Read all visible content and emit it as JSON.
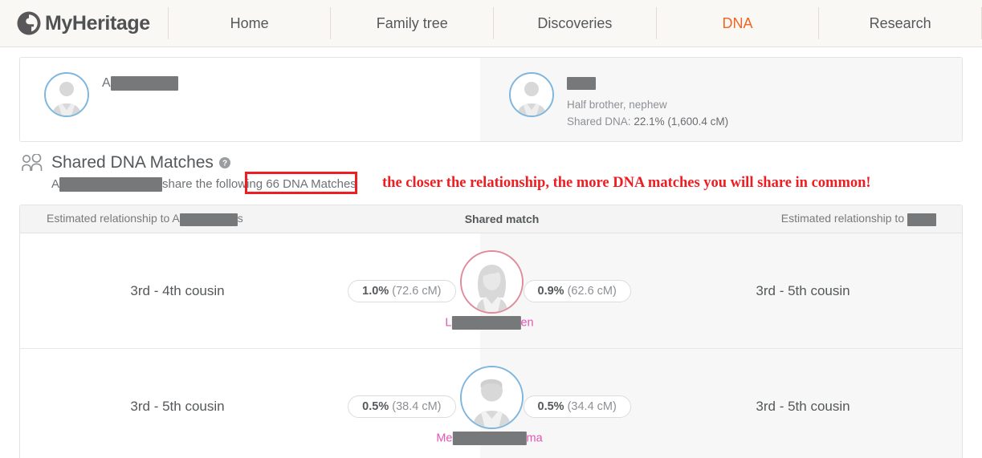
{
  "nav": {
    "logo_text": "MyHeritage",
    "logo_icon": "myheritage-tree-logo-icon",
    "items": [
      {
        "label": "Home",
        "active": false
      },
      {
        "label": "Family tree",
        "active": false
      },
      {
        "label": "Discoveries",
        "active": false
      },
      {
        "label": "DNA",
        "active": true
      },
      {
        "label": "Research",
        "active": false
      }
    ],
    "active_color": "#f26522"
  },
  "profile": {
    "left": {
      "name_prefix": "A",
      "name_redacted": true,
      "avatar_icon": "male-avatar-icon",
      "avatar_ring_color": "#7fb6dd"
    },
    "right": {
      "name_redacted": true,
      "avatar_icon": "male-avatar-icon",
      "avatar_ring_color": "#7fb6dd",
      "relationship": "Half brother, nephew",
      "shared_dna_label": "Shared DNA:",
      "shared_dna_value": "22.1% (1,600.4 cM)"
    }
  },
  "section": {
    "icon": "two-people-icon",
    "title": "Shared DNA Matches",
    "help_icon": "help-question-icon",
    "subtitle_prefix": "A",
    "subtitle_middle": "share the following 66 DNA Matches",
    "match_count": "66",
    "annotation": "the closer the relationship, the more DNA matches you will share in common!",
    "annotation_color": "#ee1d22"
  },
  "table": {
    "header": {
      "left": "Estimated relationship to A",
      "left_redacted_suffix": "s",
      "middle": "Shared match",
      "right": "Estimated relationship to"
    },
    "rows": [
      {
        "left_relationship": "3rd - 4th cousin",
        "left_pill_percent": "1.0%",
        "left_pill_cm": "(72.6 cM)",
        "right_pill_percent": "0.9%",
        "right_pill_cm": "(62.6 cM)",
        "right_relationship": "3rd - 5th cousin",
        "name_prefix": "L",
        "name_suffix": "en",
        "avatar_icon": "female-avatar-icon",
        "avatar_ring_color": "#e08b9b",
        "name_color": "#e255b4"
      },
      {
        "left_relationship": "3rd - 5th cousin",
        "left_pill_percent": "0.5%",
        "left_pill_cm": "(38.4 cM)",
        "right_pill_percent": "0.5%",
        "right_pill_cm": "(34.4 cM)",
        "right_relationship": "3rd - 5th cousin",
        "name_prefix": "Me",
        "name_suffix": "ma",
        "avatar_icon": "male-avatar-icon",
        "avatar_ring_color": "#7fb6dd",
        "name_color": "#e255b4"
      }
    ]
  }
}
